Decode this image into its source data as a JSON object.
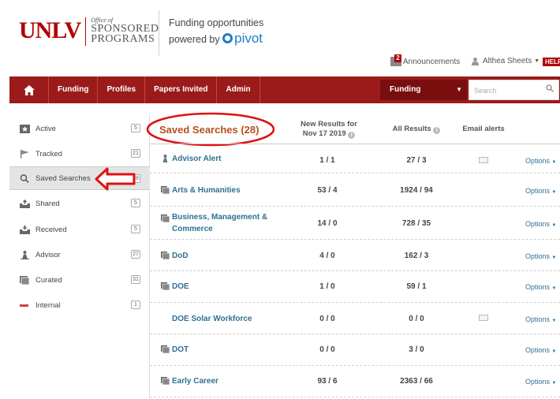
{
  "header": {
    "logo_unlv": "UNLV",
    "logo_of": "Office of",
    "logo_line1": "SPONSORED",
    "logo_line2": "PROGRAMS",
    "tagline1": "Funding opportunities",
    "tagline2": "powered by",
    "pivot": "pivot"
  },
  "utility": {
    "announcements_count": "2",
    "announcements": "Announcements",
    "user": "Althea Sheets",
    "help": "HELP"
  },
  "nav": {
    "items": [
      "Funding",
      "Profiles",
      "Papers Invited",
      "Admin"
    ],
    "select_value": "Funding",
    "search_placeholder": "Search"
  },
  "sidebar": {
    "items": [
      {
        "label": "Active",
        "count": "5"
      },
      {
        "label": "Tracked",
        "count": "21"
      },
      {
        "label": "Saved Searches",
        "count": "28"
      },
      {
        "label": "Shared",
        "count": "5"
      },
      {
        "label": "Received",
        "count": "5"
      },
      {
        "label": "Advisor",
        "count": "27"
      },
      {
        "label": "Curated",
        "count": "31"
      },
      {
        "label": "Internal",
        "count": "1"
      }
    ]
  },
  "main": {
    "title": "Saved Searches (28)",
    "col_new_line1": "New Results for",
    "col_new_line2": "Nov 17 2019",
    "col_all": "All Results",
    "col_email": "Email alerts",
    "rows": [
      {
        "name": "Advisor Alert",
        "new": "1 / 1",
        "all": "27 / 3",
        "options": "Options"
      },
      {
        "name": "Arts & Humanities",
        "new": "53 / 4",
        "all": "1924 / 94",
        "options": "Options"
      },
      {
        "name": "Business, Management & Commerce",
        "new": "14 / 0",
        "all": "728 / 35",
        "options": "Options"
      },
      {
        "name": "DoD",
        "new": "4 / 0",
        "all": "162 / 3",
        "options": "Options"
      },
      {
        "name": "DOE",
        "new": "1 / 0",
        "all": "59 / 1",
        "options": "Options"
      },
      {
        "name": "DOE Solar Workforce",
        "new": "0 / 0",
        "all": "0 / 0",
        "options": "Options"
      },
      {
        "name": "DOT",
        "new": "0 / 0",
        "all": "3 / 0",
        "options": "Options"
      },
      {
        "name": "Early Career",
        "new": "93 / 6",
        "all": "2363 / 66",
        "options": "Options"
      }
    ]
  },
  "colors": {
    "brand_red": "#9b1b1b",
    "title_orange": "#b5501c",
    "link_blue": "#2f6f93",
    "annotation_red": "#e01010"
  }
}
